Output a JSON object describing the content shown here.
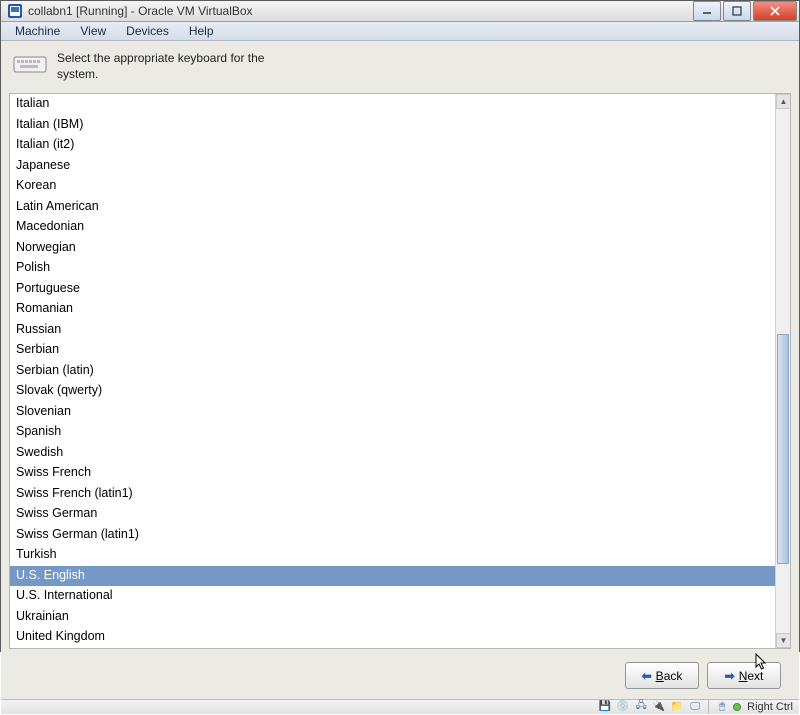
{
  "window": {
    "title": "collabn1 [Running] - Oracle VM VirtualBox"
  },
  "menubar": {
    "items": [
      "Machine",
      "View",
      "Devices",
      "Help"
    ]
  },
  "instruction": {
    "text": "Select the appropriate keyboard for the system."
  },
  "keyboard_list": {
    "items": [
      "Italian",
      "Italian (IBM)",
      "Italian (it2)",
      "Japanese",
      "Korean",
      "Latin American",
      "Macedonian",
      "Norwegian",
      "Polish",
      "Portuguese",
      "Romanian",
      "Russian",
      "Serbian",
      "Serbian (latin)",
      "Slovak (qwerty)",
      "Slovenian",
      "Spanish",
      "Swedish",
      "Swiss French",
      "Swiss French (latin1)",
      "Swiss German",
      "Swiss German (latin1)",
      "Turkish",
      "U.S. English",
      "U.S. International",
      "Ukrainian",
      "United Kingdom"
    ],
    "selected": "U.S. English"
  },
  "buttons": {
    "back": "Back",
    "next": "Next"
  },
  "statusbar": {
    "host_key": "Right Ctrl"
  }
}
